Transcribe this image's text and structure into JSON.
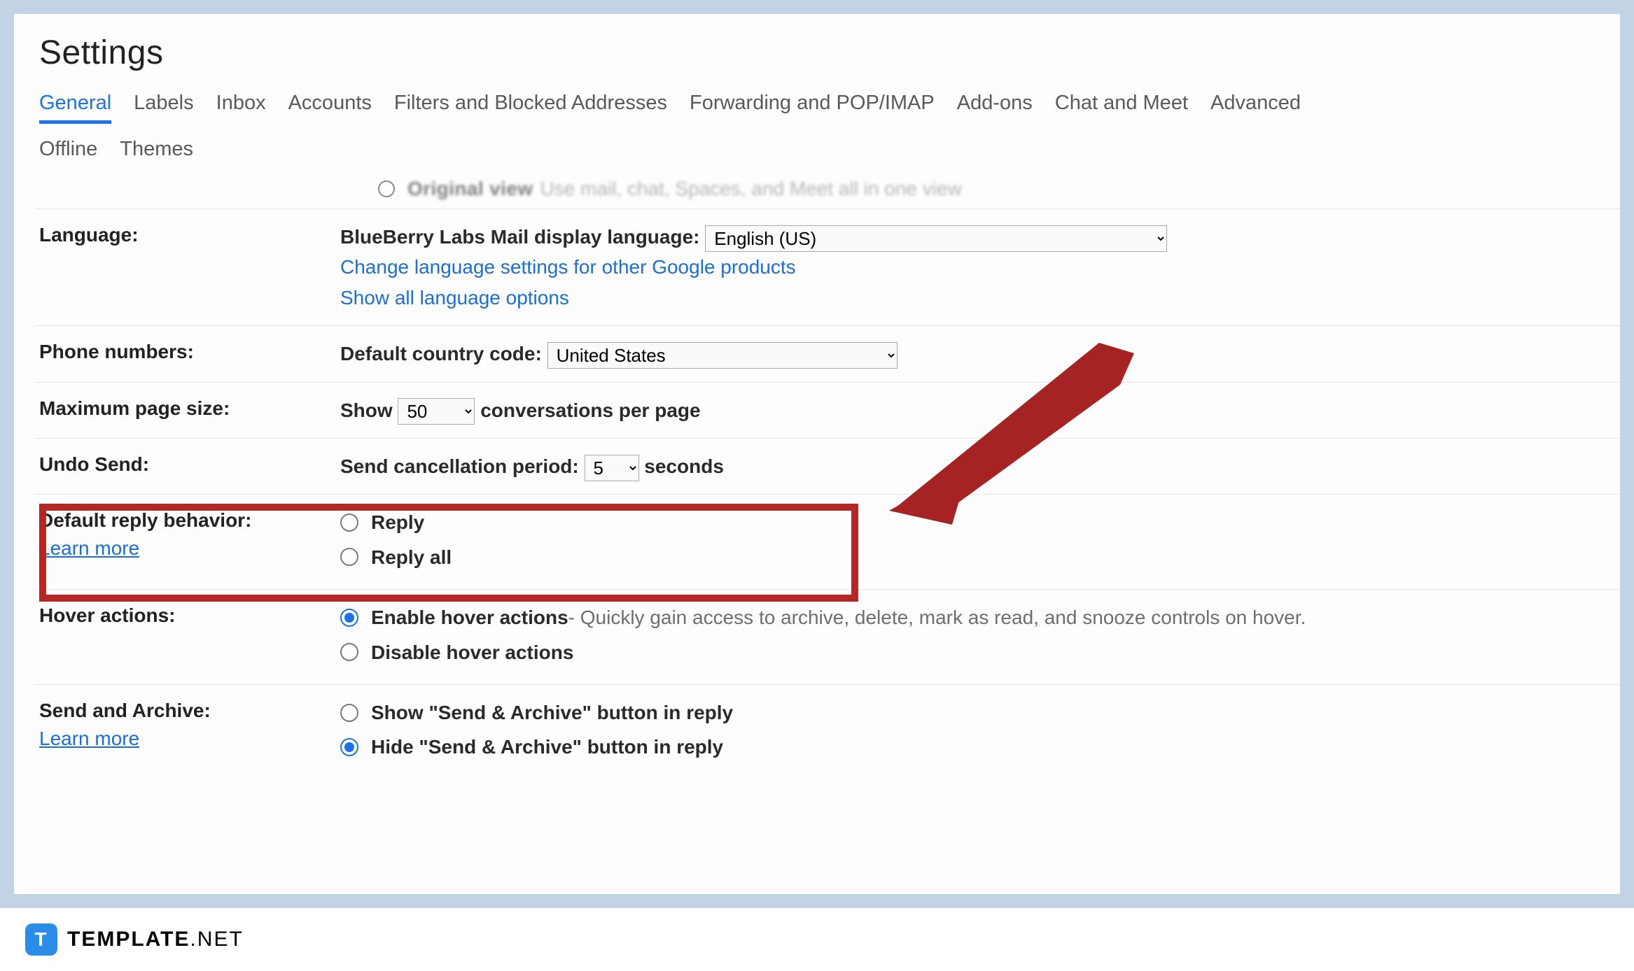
{
  "page": {
    "title": "Settings"
  },
  "tabs": {
    "row1": [
      "General",
      "Labels",
      "Inbox",
      "Accounts",
      "Filters and Blocked Addresses",
      "Forwarding and POP/IMAP",
      "Add-ons",
      "Chat and Meet",
      "Advanced"
    ],
    "row2": [
      "Offline",
      "Themes"
    ],
    "active": "General"
  },
  "cutoff_row": {
    "label": "Original view",
    "desc": "Use mail, chat, Spaces, and Meet all in one view"
  },
  "language": {
    "label": "Language:",
    "prefix": "BlueBerry Labs Mail display language:",
    "selected": "English (US)",
    "link1": "Change language settings for other Google products",
    "link2": "Show all language options"
  },
  "phone": {
    "label": "Phone numbers:",
    "prefix": "Default country code:",
    "selected": "United States"
  },
  "page_size": {
    "label": "Maximum page size:",
    "prefix": "Show",
    "value": "50",
    "suffix": "conversations per page"
  },
  "undo_send": {
    "label": "Undo Send:",
    "prefix": "Send cancellation period:",
    "value": "5",
    "suffix": "seconds"
  },
  "reply": {
    "label": "Default reply behavior:",
    "learn_more": "Learn more",
    "opt1": "Reply",
    "opt2": "Reply all",
    "selected": ""
  },
  "hover": {
    "label": "Hover actions:",
    "opt1": "Enable hover actions",
    "opt1_desc": " - Quickly gain access to archive, delete, mark as read, and snooze controls on hover.",
    "opt2": "Disable hover actions",
    "selected": "opt1"
  },
  "send_archive": {
    "label": "Send and Archive:",
    "learn_more": "Learn more",
    "opt1": "Show \"Send & Archive\" button in reply",
    "opt2": "Hide \"Send & Archive\" button in reply",
    "selected": "opt2"
  },
  "footer": {
    "logo_letter": "T",
    "brand_strong": "TEMPLATE",
    "brand_tld": ".NET"
  },
  "highlight": {
    "section": "undo_send"
  }
}
